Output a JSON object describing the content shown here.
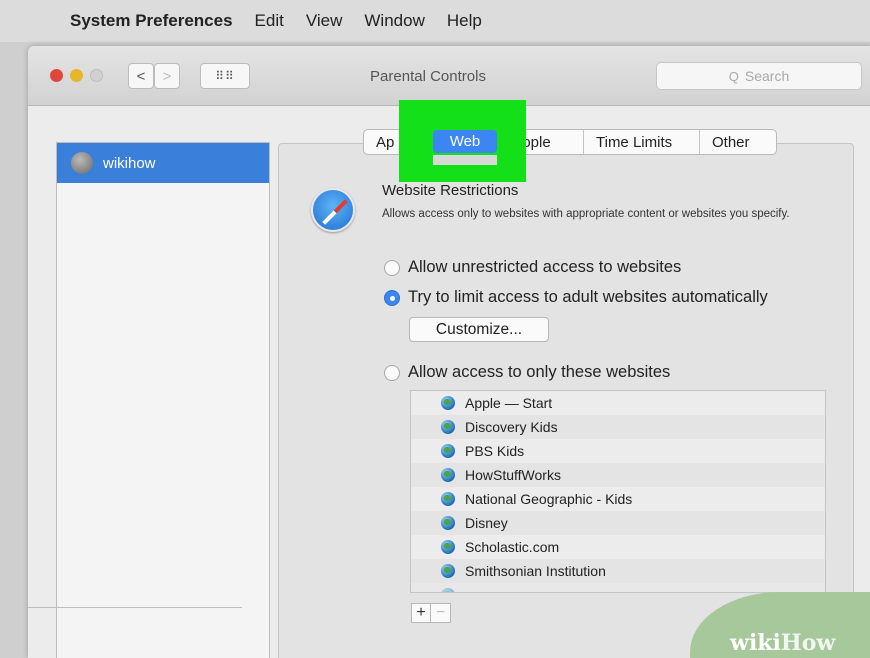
{
  "menubar": {
    "apple_icon": "apple-icon",
    "app_name": "System Preferences",
    "items": [
      "Edit",
      "View",
      "Window",
      "Help"
    ]
  },
  "window": {
    "title": "Parental Controls",
    "search_placeholder": "Search",
    "back_glyph": "<",
    "forward_glyph": ">",
    "grid_glyph": "⠿⠿"
  },
  "users": [
    {
      "name": "wikihow",
      "selected": true
    }
  ],
  "tabs": {
    "apps": "Ap",
    "web": "Web",
    "people": "eople",
    "time_limits": "Time Limits",
    "other": "Other",
    "active": "Web",
    "highlight_color": "#14e01a"
  },
  "web": {
    "section_title": "Website Restrictions",
    "section_desc": "Allows access only to websites with appropriate content or websites you specify.",
    "options": [
      {
        "label": "Allow unrestricted access to websites",
        "selected": false
      },
      {
        "label": "Try to limit access to adult websites automatically",
        "selected": true
      },
      {
        "label": "Allow access to only these websites",
        "selected": false
      }
    ],
    "customize_label": "Customize...",
    "sites": [
      "Apple — Start",
      "Discovery Kids",
      "PBS Kids",
      "HowStuffWorks",
      "National Geographic - Kids",
      "Disney",
      "Scholastic.com",
      "Smithsonian Institution"
    ],
    "add_label": "+",
    "remove_label": "−"
  },
  "watermark": {
    "part1": "wiki",
    "part2": "How"
  },
  "colors": {
    "accent": "#3b86f2",
    "selection": "#3a7fd9"
  }
}
